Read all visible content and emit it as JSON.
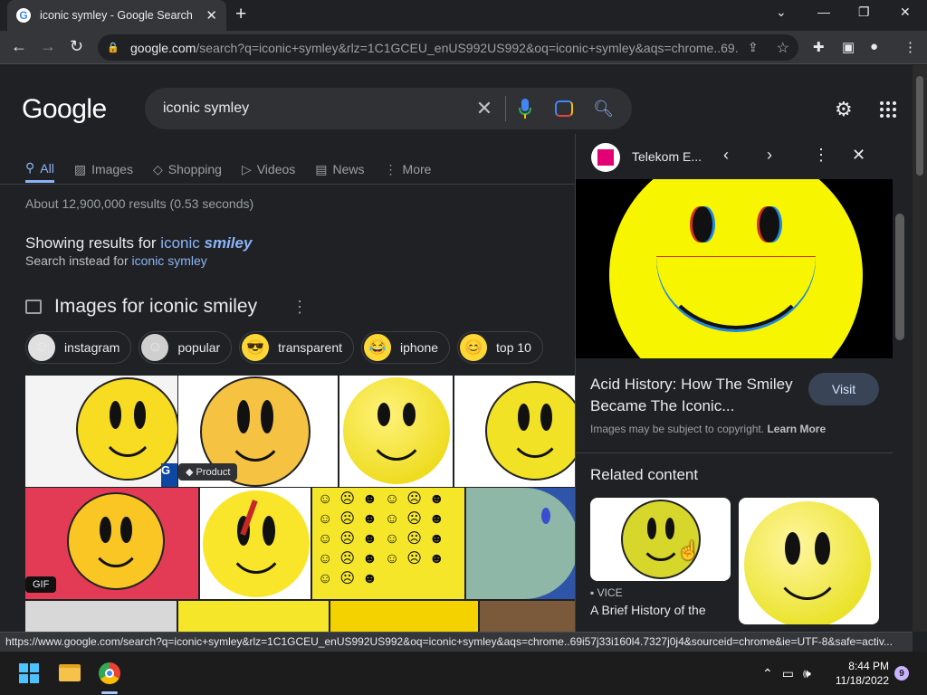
{
  "browser": {
    "tab_title": "iconic symley - Google Search",
    "url_domain": "google.com",
    "url_path": "/search?q=iconic+symley&rlz=1C1GCEU_enUS992US992&oq=iconic+symley&aqs=chrome..69...",
    "new_tab_icon": "plus-icon"
  },
  "search": {
    "logo": "Google",
    "query": "iconic symley"
  },
  "nav_tabs": [
    {
      "label": "All",
      "icon": "search-icon",
      "active": true
    },
    {
      "label": "Images",
      "icon": "image-icon"
    },
    {
      "label": "Shopping",
      "icon": "tag-icon"
    },
    {
      "label": "Videos",
      "icon": "play-icon"
    },
    {
      "label": "News",
      "icon": "news-icon"
    },
    {
      "label": "More",
      "icon": "more-vert-icon"
    }
  ],
  "results": {
    "stats": "About 12,900,000 results (0.53 seconds)",
    "showing_prefix": "Showing results for ",
    "showing_word1": "iconic",
    "showing_word2": "smiley",
    "instead_prefix": "Search instead for ",
    "instead_link": "iconic symley",
    "images_heading": "Images for iconic smiley"
  },
  "chips": [
    {
      "label": "instagram"
    },
    {
      "label": "popular"
    },
    {
      "label": "transparent"
    },
    {
      "label": "iphone"
    },
    {
      "label": "top 10"
    }
  ],
  "grid_tags": {
    "product": "Product",
    "gif": "GIF"
  },
  "panel": {
    "source": "Telekom E...",
    "title": "Acid History: How The Smiley Became The Iconic...",
    "visit": "Visit",
    "copyright": "Images may be subject to copyright.",
    "learn_more": "Learn More",
    "related_heading": "Related content",
    "related_source": "VICE",
    "related_caption": "A Brief History of the"
  },
  "status_url": "https://www.google.com/search?q=iconic+symley&rlz=1C1GCEU_enUS992US992&oq=iconic+symley&aqs=chrome..69i57j33i160l4.7327j0j4&sourceid=chrome&ie=UTF-8&safe=activ...",
  "taskbar": {
    "time": "8:44 PM",
    "date": "11/18/2022",
    "notifications": "9"
  },
  "colors": {
    "background": "#202124",
    "link": "#8ab4f8",
    "smiley": "#f7dc21"
  }
}
